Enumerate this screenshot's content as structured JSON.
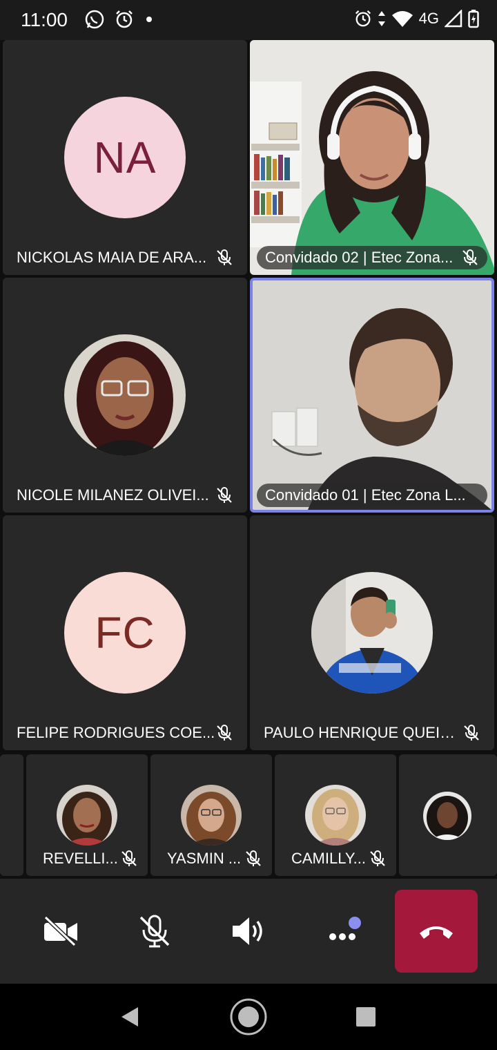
{
  "status": {
    "time": "11:00",
    "network": "4G",
    "icons": [
      "whatsapp-icon",
      "alarm-icon",
      "dot-icon",
      "alarm-icon",
      "data-arrows-icon",
      "wifi-icon",
      "signal-icon",
      "battery-icon"
    ]
  },
  "participants": [
    {
      "name": "NICKOLAS MAIA DE ARA...",
      "initials": "NA",
      "avatar_bg": "#f5d4dd",
      "initials_color": "#7a1f3d",
      "muted": true
    },
    {
      "name": "Convidado 02 | Etec Zona...",
      "video": true,
      "muted": true
    },
    {
      "name": "NICOLE MILANEZ OLIVEI...",
      "photo": "woman-with-glasses",
      "muted": true
    },
    {
      "name": "Convidado 01 | Etec Zona L...",
      "video": true,
      "active_speaker": true
    },
    {
      "name": "FELIPE RODRIGUES COE...",
      "initials": "FC",
      "avatar_bg": "#fadcd6",
      "initials_color": "#7a2a22",
      "muted": true
    },
    {
      "name": "PAULO HENRIQUE QUEIR...",
      "photo": "man-in-blue-jacket",
      "muted": true
    }
  ],
  "small_participants": [
    {
      "name": "REVELLI...",
      "muted": true
    },
    {
      "name": "YASMIN ...",
      "muted": true
    },
    {
      "name": "CAMILLY...",
      "muted": true
    },
    {
      "name": "",
      "muted": false
    }
  ],
  "controls": {
    "camera_icon": "camera-off-icon",
    "mic_icon": "mic-off-icon",
    "speaker_icon": "speaker-icon",
    "more_icon": "more-options-icon",
    "end_call_icon": "hang-up-icon",
    "notification_dot_color": "#8b8ff0",
    "end_call_color": "#a4183b"
  },
  "navigation": [
    "back-icon",
    "home-icon",
    "recents-icon"
  ]
}
